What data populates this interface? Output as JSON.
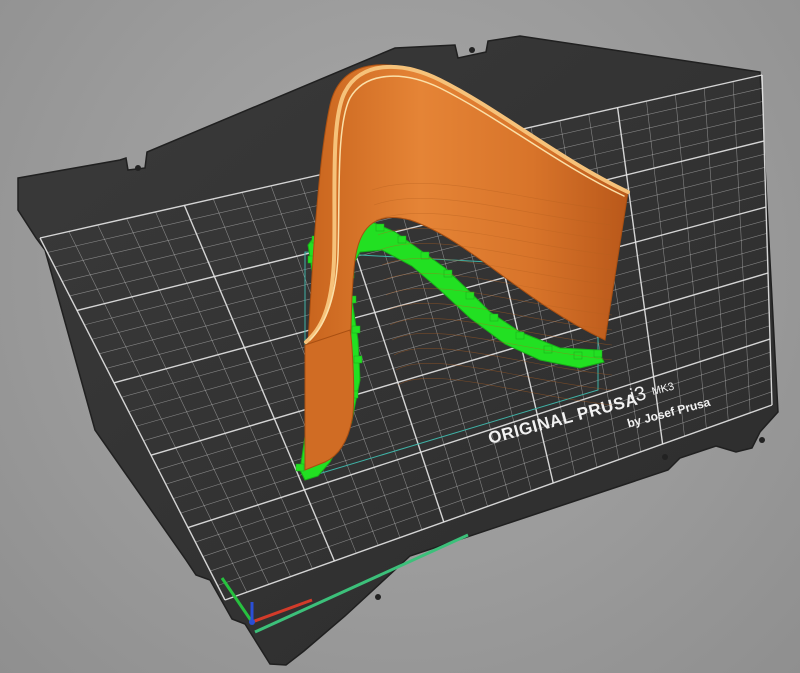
{
  "viewport": {
    "background": "#9a9a9a"
  },
  "bed": {
    "brand_line": "ORIGINAL PRUSA",
    "model_prefix": "i3",
    "model_suffix": "MK3",
    "byline": "by Josef Prusa",
    "sheet_color": "#333333",
    "grid_color": "#e6e6e6"
  },
  "model": {
    "shape": "curved-wall",
    "color": "#e07d2a",
    "support_color": "#22e022",
    "bounding_box_color": "#3fb2a6"
  },
  "axes": {
    "x_color": "#d23b2a",
    "y_color": "#27c13f",
    "z_color": "#2a4fd6"
  }
}
